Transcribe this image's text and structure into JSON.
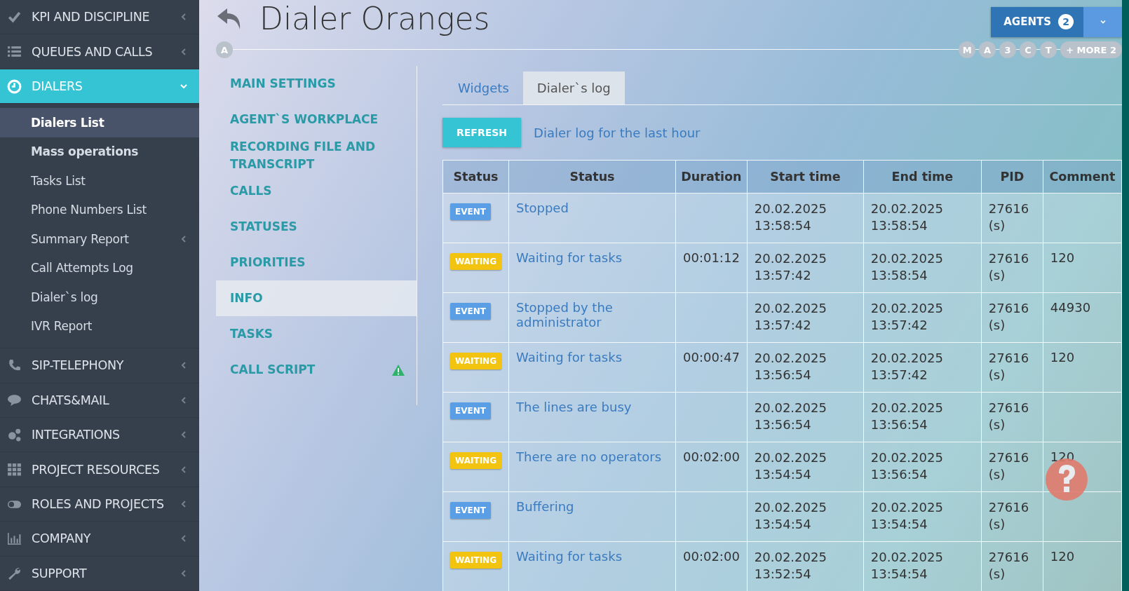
{
  "sidebar": {
    "items": [
      {
        "label": "KPI AND DISCIPLINE",
        "expanded": false,
        "selected": false
      },
      {
        "label": "QUEUES AND CALLS",
        "expanded": false,
        "selected": false
      },
      {
        "label": "DIALERS",
        "expanded": true,
        "selected": true,
        "children": [
          {
            "label": "Dialers List",
            "bold": true,
            "selected": true,
            "has_arrow": false
          },
          {
            "label": "Mass operations",
            "bold": true,
            "selected": false,
            "has_arrow": false
          },
          {
            "label": "Tasks List",
            "bold": false,
            "selected": false,
            "has_arrow": false
          },
          {
            "label": "Phone Numbers List",
            "bold": false,
            "selected": false,
            "has_arrow": false
          },
          {
            "label": "Summary Report",
            "bold": false,
            "selected": false,
            "has_arrow": true
          },
          {
            "label": "Call Attempts Log",
            "bold": false,
            "selected": false,
            "has_arrow": false
          },
          {
            "label": "Dialer`s log",
            "bold": false,
            "selected": false,
            "has_arrow": false
          },
          {
            "label": "IVR Report",
            "bold": false,
            "selected": false,
            "has_arrow": false
          }
        ]
      },
      {
        "label": "SIP-TELEPHONY",
        "expanded": false,
        "selected": false
      },
      {
        "label": "CHATS&MAIL",
        "expanded": false,
        "selected": false
      },
      {
        "label": "INTEGRATIONS",
        "expanded": false,
        "selected": false
      },
      {
        "label": "PROJECT RESOURCES",
        "expanded": false,
        "selected": false
      },
      {
        "label": "ROLES AND PROJECTS",
        "expanded": false,
        "selected": false
      },
      {
        "label": "COMPANY",
        "expanded": false,
        "selected": false
      },
      {
        "label": "SUPPORT",
        "expanded": false,
        "selected": false
      }
    ]
  },
  "header": {
    "title": "Dialer Oranges",
    "owner_chip": "A",
    "agents_button": {
      "label": "AGENTS",
      "count": "2"
    },
    "agent_chips": [
      "M",
      "A",
      "3",
      "C",
      "T"
    ],
    "more_chip": "+ MORE 2"
  },
  "settings_menu": [
    {
      "label": "MAIN SETTINGS",
      "selected": false,
      "warning": false
    },
    {
      "label": "AGENT`S WORKPLACE",
      "selected": false,
      "warning": false
    },
    {
      "label": "RECORDING FILE AND TRANSCRIPT",
      "selected": false,
      "warning": false
    },
    {
      "label": "CALLS",
      "selected": false,
      "warning": false
    },
    {
      "label": "STATUSES",
      "selected": false,
      "warning": false
    },
    {
      "label": "PRIORITIES",
      "selected": false,
      "warning": false
    },
    {
      "label": "INFO",
      "selected": true,
      "warning": false
    },
    {
      "label": "TASKS",
      "selected": false,
      "warning": false
    },
    {
      "label": "CALL SCRIPT",
      "selected": false,
      "warning": true
    }
  ],
  "tabs": [
    {
      "label": "Widgets",
      "selected": false
    },
    {
      "label": "Dialer`s log",
      "selected": true
    }
  ],
  "refresh_button": "REFRESH",
  "log_caption": "Dialer log for the last hour",
  "table": {
    "columns": [
      "Status",
      "Status",
      "Duration",
      "Start time",
      "End time",
      "PID",
      "Comment"
    ],
    "rows": [
      {
        "kind": "event",
        "badge": "EVENT",
        "status": "Stopped",
        "duration": "",
        "start": "20.02.2025 13:58:54",
        "end": "20.02.2025 13:58:54",
        "pid": "27616 (s)",
        "comment": ""
      },
      {
        "kind": "waiting",
        "badge": "WAITING",
        "status": "Waiting for tasks",
        "duration": "00:01:12",
        "start": "20.02.2025 13:57:42",
        "end": "20.02.2025 13:58:54",
        "pid": "27616 (s)",
        "comment": "120"
      },
      {
        "kind": "event",
        "badge": "EVENT",
        "status": "Stopped by the administrator",
        "duration": "",
        "start": "20.02.2025 13:57:42",
        "end": "20.02.2025 13:57:42",
        "pid": "27616 (s)",
        "comment": "44930"
      },
      {
        "kind": "waiting",
        "badge": "WAITING",
        "status": "Waiting for tasks",
        "duration": "00:00:47",
        "start": "20.02.2025 13:56:54",
        "end": "20.02.2025 13:57:42",
        "pid": "27616 (s)",
        "comment": "120"
      },
      {
        "kind": "event",
        "badge": "EVENT",
        "status": "The lines are busy",
        "duration": "",
        "start": "20.02.2025 13:56:54",
        "end": "20.02.2025 13:56:54",
        "pid": "27616 (s)",
        "comment": ""
      },
      {
        "kind": "waiting",
        "badge": "WAITING",
        "status": "There are no operators",
        "duration": "00:02:00",
        "start": "20.02.2025 13:54:54",
        "end": "20.02.2025 13:56:54",
        "pid": "27616 (s)",
        "comment": "120"
      },
      {
        "kind": "event",
        "badge": "EVENT",
        "status": "Buffering",
        "duration": "",
        "start": "20.02.2025 13:54:54",
        "end": "20.02.2025 13:54:54",
        "pid": "27616 (s)",
        "comment": ""
      },
      {
        "kind": "waiting",
        "badge": "WAITING",
        "status": "Waiting for tasks",
        "duration": "00:02:00",
        "start": "20.02.2025 13:52:54",
        "end": "20.02.2025 13:54:54",
        "pid": "27616 (s)",
        "comment": "120"
      }
    ]
  }
}
